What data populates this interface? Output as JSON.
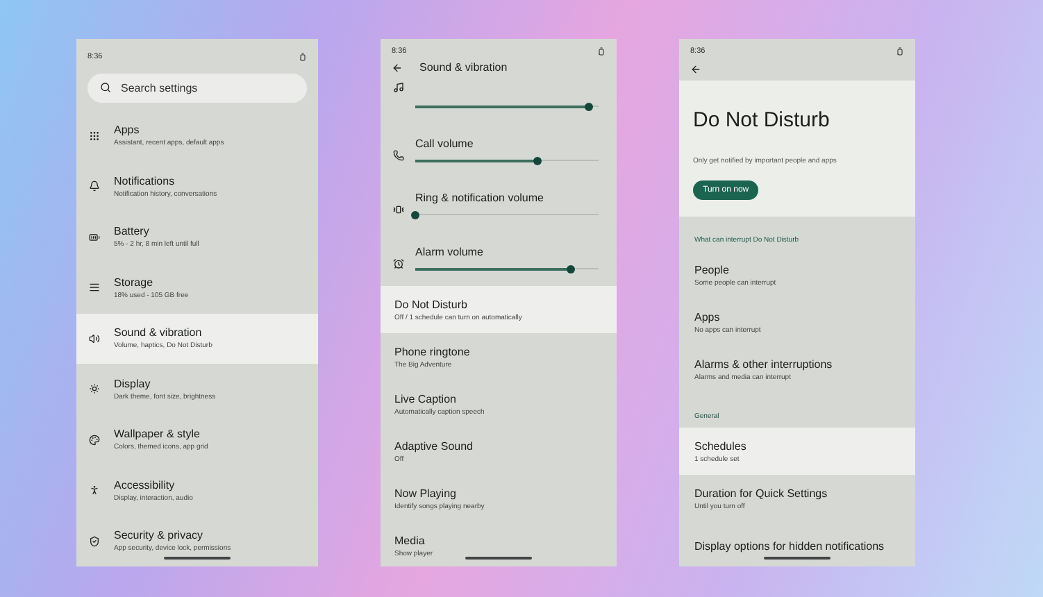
{
  "settings_screen": {
    "status_time": "8:36",
    "search": {
      "placeholder": "Search settings"
    },
    "items": [
      {
        "title": "Apps",
        "subtitle": "Assistant, recent apps, default apps",
        "selected": false
      },
      {
        "title": "Notifications",
        "subtitle": "Notification history, conversations",
        "selected": false
      },
      {
        "title": "Battery",
        "subtitle": "5% - 2 hr, 8 min left until full",
        "selected": false
      },
      {
        "title": "Storage",
        "subtitle": "18% used - 105 GB free",
        "selected": false
      },
      {
        "title": "Sound & vibration",
        "subtitle": "Volume, haptics, Do Not Disturb",
        "selected": true
      },
      {
        "title": "Display",
        "subtitle": "Dark theme, font size, brightness",
        "selected": false
      },
      {
        "title": "Wallpaper & style",
        "subtitle": "Colors, themed icons, app grid",
        "selected": false
      },
      {
        "title": "Accessibility",
        "subtitle": "Display, interaction, audio",
        "selected": false
      },
      {
        "title": "Security & privacy",
        "subtitle": "App security, device lock, permissions",
        "selected": false
      }
    ]
  },
  "sound_screen": {
    "status_time": "8:36",
    "title": "Sound & vibration",
    "sliders": [
      {
        "level": 0.95
      },
      {
        "label": "Call volume",
        "level": 0.67
      },
      {
        "label": "Ring & notification volume",
        "level": 0.0
      },
      {
        "label": "Alarm volume",
        "level": 0.85
      }
    ],
    "items": [
      {
        "title": "Do Not Disturb",
        "subtitle": "Off / 1 schedule can turn on automatically",
        "selected": true
      },
      {
        "title": "Phone ringtone",
        "subtitle": "The Big Adventure",
        "selected": false
      },
      {
        "title": "Live Caption",
        "subtitle": "Automatically caption speech",
        "selected": false
      },
      {
        "title": "Adaptive Sound",
        "subtitle": "Off",
        "selected": false
      },
      {
        "title": "Now Playing",
        "subtitle": "Identify songs playing nearby",
        "selected": false
      },
      {
        "title": "Media",
        "subtitle": "Show player",
        "selected": false
      }
    ]
  },
  "dnd_screen": {
    "status_time": "8:36",
    "title": "Do Not Disturb",
    "description": "Only get notified by important people and apps",
    "button": "Turn on now",
    "sections": [
      {
        "heading": "What can interrupt Do Not Disturb",
        "items": [
          {
            "title": "People",
            "subtitle": "Some people can interrupt",
            "selected": false
          },
          {
            "title": "Apps",
            "subtitle": "No apps can interrupt",
            "selected": false
          },
          {
            "title": "Alarms & other interruptions",
            "subtitle": "Alarms and media can interrupt",
            "selected": false
          }
        ]
      },
      {
        "heading": "General",
        "items": [
          {
            "title": "Schedules",
            "subtitle": "1 schedule set",
            "selected": true
          },
          {
            "title": "Duration for Quick Settings",
            "subtitle": "Until you turn off",
            "selected": false
          },
          {
            "title": "Display options for hidden notifications",
            "selected": false
          }
        ]
      }
    ]
  }
}
